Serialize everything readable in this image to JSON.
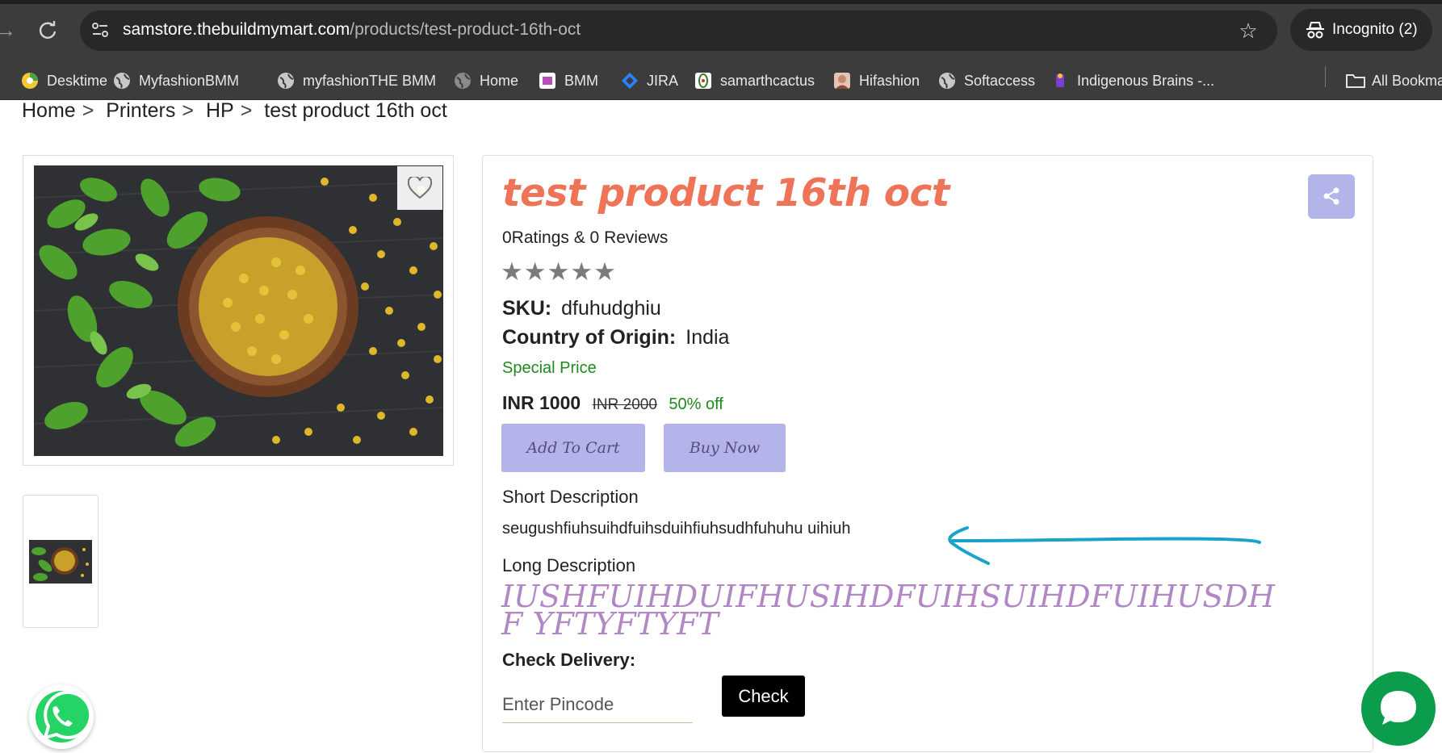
{
  "browser": {
    "url_host": "samstore.thebuildmymart.com",
    "url_path": "/products/test-product-16th-oct",
    "incognito_label": "Incognito (2)",
    "bookmarks": [
      {
        "label": "Desktime",
        "icon": "desktime-icon"
      },
      {
        "label": "MyfashionBMM",
        "icon": "globe-icon"
      },
      {
        "label": "myfashionTHE BMM",
        "icon": "globe-icon"
      },
      {
        "label": "Home",
        "icon": "globe-icon"
      },
      {
        "label": "BMM",
        "icon": "bmm-icon"
      },
      {
        "label": "JIRA",
        "icon": "jira-icon"
      },
      {
        "label": "samarthcactus",
        "icon": "cactus-icon"
      },
      {
        "label": "Hifashion",
        "icon": "hifashion-icon"
      },
      {
        "label": "Softaccess",
        "icon": "globe-icon"
      },
      {
        "label": "Indigenous Brains -...",
        "icon": "indigenous-icon"
      },
      {
        "label": "All Bookma",
        "icon": "folder-icon"
      }
    ]
  },
  "breadcrumb": [
    "Home",
    "Printers",
    "HP",
    "test product 16th oct"
  ],
  "breadcrumb_sep": ">",
  "product": {
    "title": "test product 16th oct",
    "ratings_text": "0Ratings & 0 Reviews",
    "stars": "★★★★★",
    "rating_value": 0,
    "sku_label": "SKU:",
    "sku": "dfuhudghiu",
    "origin_label": "Country of Origin:",
    "origin": "India",
    "special_price_label": "Special Price",
    "price": "INR 1000",
    "original_price": "INR 2000",
    "discount": "50% off",
    "add_to_cart": "Add To Cart",
    "buy_now": "Buy Now",
    "short_desc_title": "Short Description",
    "short_desc": "seugushfiuhsuihdfuihsduihfiuhsudhfuhuhu uihiuh",
    "long_desc_title": "Long Description",
    "long_desc": "IUSHFUIHDUIFHUSIHDFUIHSUIHDFUIHUSDHF YFTYFTYFT",
    "check_delivery_label": "Check Delivery:",
    "pincode_placeholder": "Enter Pincode",
    "check_button": "Check"
  },
  "colors": {
    "title": "#ee7357",
    "button_bg": "#b3b5ea",
    "long_desc": "#b187c4",
    "price_green": "#1e8a1e",
    "annotation_arrow": "#1aa3c9",
    "chat_green": "#0c9d4c"
  }
}
